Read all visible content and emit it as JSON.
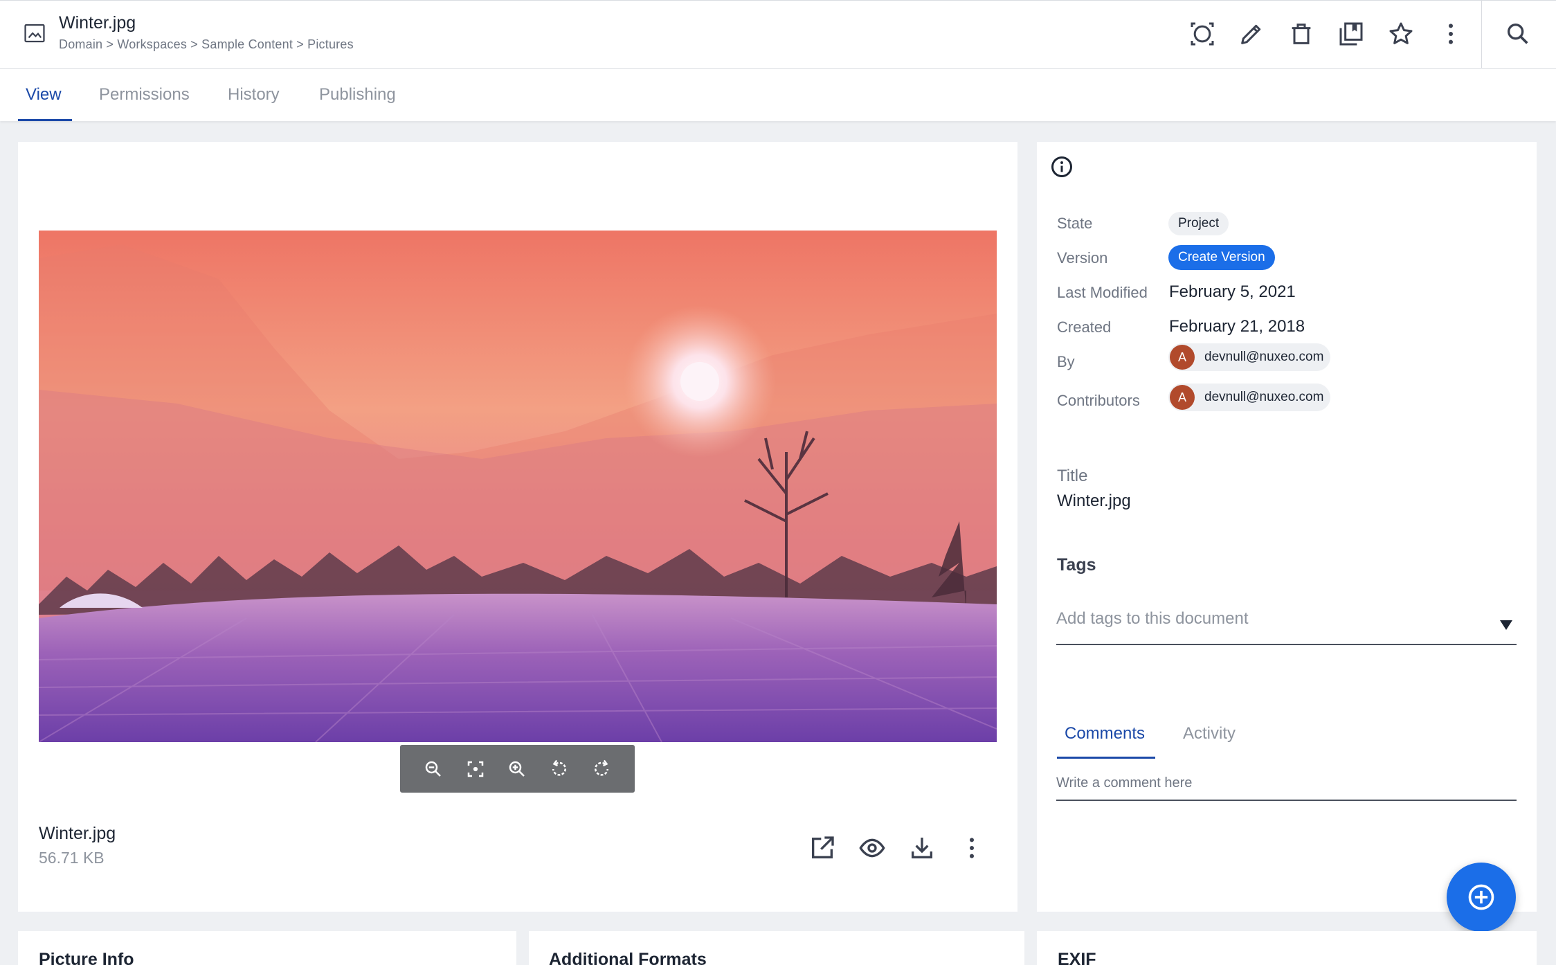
{
  "header": {
    "title": "Winter.jpg",
    "breadcrumb": "Domain > Workspaces > Sample Content > Pictures",
    "actions": [
      "compare-icon",
      "edit-icon",
      "delete-icon",
      "add-to-collection-icon",
      "favorite-icon",
      "more-vert-icon",
      "search-icon"
    ]
  },
  "tabs": [
    {
      "label": "View",
      "active": true
    },
    {
      "label": "Permissions",
      "active": false
    },
    {
      "label": "History",
      "active": false
    },
    {
      "label": "Publishing",
      "active": false
    }
  ],
  "viewer": {
    "toolbar": [
      "zoom-out-icon",
      "fit-icon",
      "zoom-in-icon",
      "rotate-left-icon",
      "rotate-right-icon"
    ]
  },
  "file": {
    "name": "Winter.jpg",
    "size": "56.71 KB",
    "actions": [
      "open-external-icon",
      "preview-icon",
      "download-icon",
      "more-vert-icon"
    ]
  },
  "metadata": {
    "state_label": "State",
    "state_value": "Project",
    "version_label": "Version",
    "version_button": "Create Version",
    "modified_label": "Last Modified",
    "modified_value": "February 5, 2021",
    "created_label": "Created",
    "created_value": "February 21, 2018",
    "by_label": "By",
    "by_initial": "A",
    "by_value": "devnull@nuxeo.com",
    "contributors_label": "Contributors",
    "contributor_initial": "A",
    "contributor_value": "devnull@nuxeo.com"
  },
  "title_field": {
    "label": "Title",
    "value": "Winter.jpg"
  },
  "tags": {
    "heading": "Tags",
    "placeholder": "Add tags to this document"
  },
  "side_tabs": [
    {
      "label": "Comments",
      "active": true
    },
    {
      "label": "Activity",
      "active": false
    }
  ],
  "comment": {
    "placeholder": "Write a comment here"
  },
  "bottom_cards": [
    {
      "title": "Picture Info"
    },
    {
      "title": "Additional Formats"
    },
    {
      "title": "EXIF"
    }
  ],
  "colors": {
    "accent": "#1b49a8",
    "primary_button": "#1b6ee8",
    "avatar": "#b14a2c"
  }
}
